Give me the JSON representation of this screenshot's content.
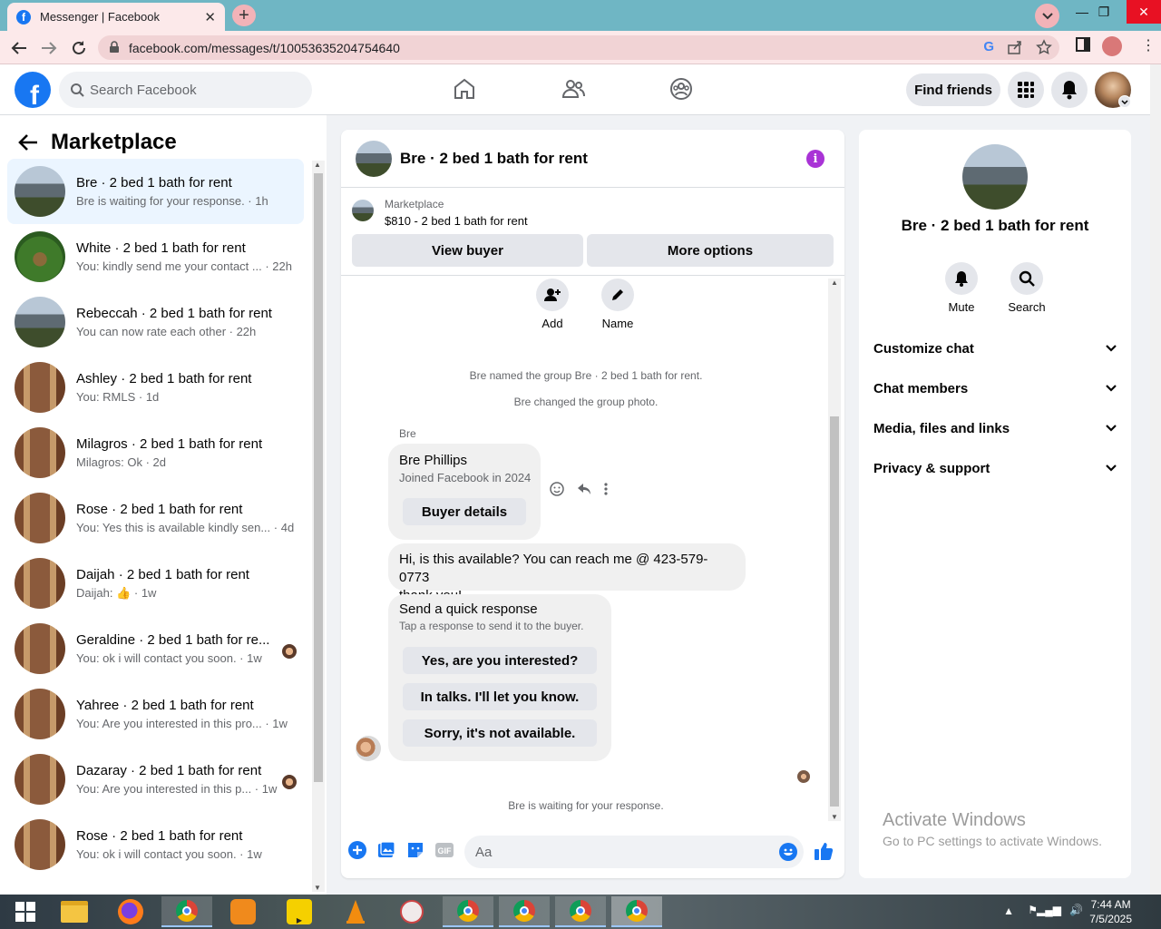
{
  "browser": {
    "tab_title": "Messenger | Facebook",
    "url": "facebook.com/messages/t/10053635204754640"
  },
  "header": {
    "search_placeholder": "Search Facebook",
    "find_friends": "Find friends"
  },
  "sidebar": {
    "title": "Marketplace",
    "conversations": [
      {
        "name": "Bre · 2 bed 1 bath for rent",
        "preview": "Bre is waiting for your response. · 1h",
        "thumb": "house",
        "active": true
      },
      {
        "name": "White · 2 bed 1 bath for rent",
        "preview": "You: kindly send me your contact ... · 22h",
        "thumb": "garden"
      },
      {
        "name": "Rebeccah · 2 bed 1 bath for rent",
        "preview": "You can now rate each other · 22h",
        "thumb": "house"
      },
      {
        "name": "Ashley · 2 bed 1 bath for rent",
        "preview": "You: RMLS · 1d",
        "thumb": "porch"
      },
      {
        "name": "Milagros · 2 bed 1 bath for rent",
        "preview": "Milagros: Ok · 2d",
        "thumb": "porch"
      },
      {
        "name": "Rose · 2 bed 1 bath for rent",
        "preview": "You: Yes this is available kindly sen... · 4d",
        "thumb": "porch"
      },
      {
        "name": "Daijah · 2 bed 1 bath for rent",
        "preview": "Daijah: 👍 · 1w",
        "thumb": "porch"
      },
      {
        "name": "Geraldine · 2 bed 1 bath for re...",
        "preview": "You: ok i will contact you soon. · 1w",
        "thumb": "porch",
        "read_avatar": true
      },
      {
        "name": "Yahree · 2 bed 1 bath for rent",
        "preview": "You: Are you interested in this pro... · 1w",
        "thumb": "porch"
      },
      {
        "name": "Dazaray · 2 bed 1 bath for rent",
        "preview": "You: Are you interested in this p... · 1w",
        "thumb": "porch",
        "read_avatar": true
      },
      {
        "name": "Rose · 2 bed 1 bath for rent",
        "preview": "You: ok i will contact you soon. · 1w",
        "thumb": "porch"
      }
    ]
  },
  "chat": {
    "title": "Bre · 2 bed 1 bath for rent",
    "listing_source": "Marketplace",
    "listing_price": "$810 - 2 bed 1 bath for rent",
    "view_buyer": "View buyer",
    "more_options": "More options",
    "add_label": "Add",
    "name_label": "Name",
    "sys1": "Bre named the group Bre · 2 bed 1 bath for rent.",
    "sys2": "Bre changed the group photo.",
    "sender": "Bre",
    "card_name": "Bre Phillips",
    "card_joined": "Joined Facebook in 2024",
    "buyer_details": "Buyer details",
    "message_line1": "Hi, is this available? You can reach me @ 423-579-0773",
    "message_line2": "thank you!",
    "quick_title": "Send a quick response",
    "quick_sub": "Tap a response to send it to the buyer.",
    "quick_replies": [
      "Yes, are you interested?",
      "In talks. I'll let you know.",
      "Sorry, it's not available."
    ],
    "waiting": "Bre is waiting for your response.",
    "composer_placeholder": "Aa"
  },
  "details": {
    "name": "Bre · 2 bed 1 bath for rent",
    "mute": "Mute",
    "search": "Search",
    "sections": [
      "Customize chat",
      "Chat members",
      "Media, files and links",
      "Privacy & support"
    ],
    "watermark1": "Activate Windows",
    "watermark2": "Go to PC settings to activate Windows."
  },
  "taskbar": {
    "time": "7:44 AM",
    "date": "7/5/2025"
  },
  "colors": {
    "fb_blue": "#1877f2",
    "active_conv": "#ebf5ff",
    "info_purple": "#a933d6"
  }
}
